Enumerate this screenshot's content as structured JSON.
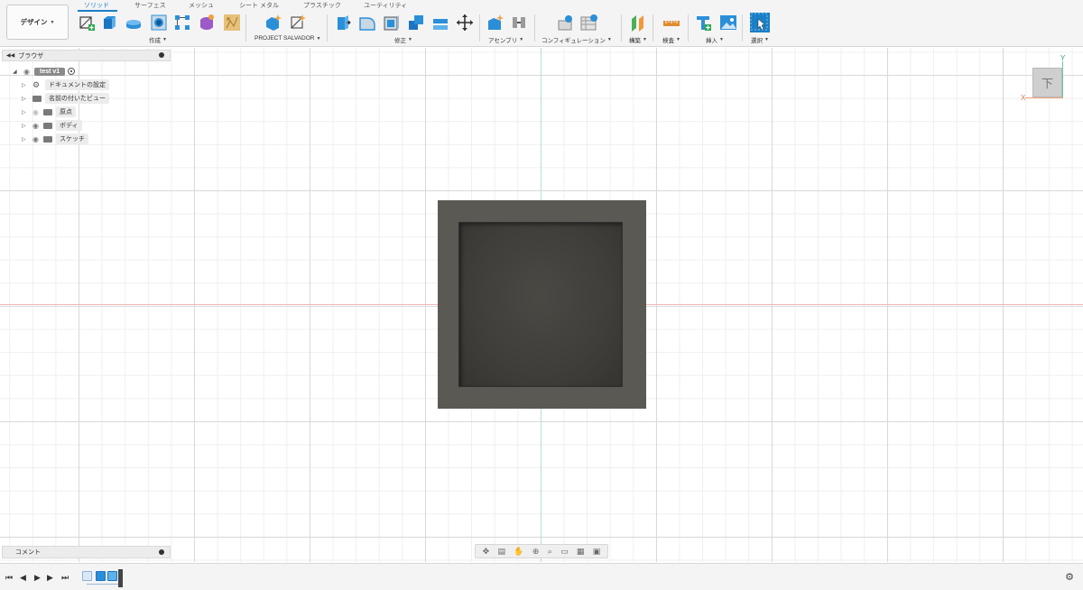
{
  "toolbar": {
    "workspace_label": "デザイン",
    "tabs": [
      "ソリッド",
      "サーフェス",
      "メッシュ",
      "シート メタル",
      "プラスチック",
      "ユーティリティ"
    ],
    "groups": {
      "create": "作成",
      "project": "PROJECT SALVADOR",
      "modify": "修正",
      "assemble": "アセンブリ",
      "configure": "コンフィギュレーション",
      "construct": "構築",
      "inspect": "検査",
      "insert": "挿入",
      "select": "選択"
    }
  },
  "browser": {
    "title": "ブラウザ",
    "root": "test v1",
    "items": [
      "ドキュメントの設定",
      "名前の付いたビュー",
      "原点",
      "ボディ",
      "スケッチ"
    ]
  },
  "comments": {
    "label": "コメント"
  },
  "viewcube": {
    "face": "下",
    "axis_y": "Y",
    "axis_x": "X"
  },
  "colors": {
    "accent": "#1a7fc6",
    "model": "#5b5953",
    "model_inner": "#3f3e3a"
  }
}
